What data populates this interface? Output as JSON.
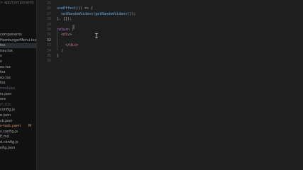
{
  "sidebar": {
    "breadcrumb": "> app/components",
    "items": [
      {
        "label": "components",
        "state": "normal"
      },
      {
        "label": "HamburgerMenu.tsx",
        "state": "normal"
      },
      {
        "label": "tsx",
        "state": "selected"
      },
      {
        "label": "nav.tsx",
        "state": "normal"
      },
      {
        "label": "s",
        "state": "normal"
      },
      {
        "label": "s",
        "state": "normal"
      },
      {
        "label": "ex.tsx",
        "state": "normal"
      },
      {
        "label": "tsx",
        "state": "normal"
      },
      {
        "label": "ex.tsx",
        "state": "normal"
      },
      {
        "label": "tsx",
        "state": "normal"
      },
      {
        "label": "modules",
        "state": "dim"
      },
      {
        "label": "rs.json",
        "state": "normal"
      },
      {
        "label": "ore",
        "state": "normal"
      },
      {
        "label": "m.d.ts",
        "state": "dim"
      },
      {
        "label": "config.js",
        "state": "normal"
      },
      {
        "label": "e.json",
        "state": "normal"
      },
      {
        "label": "ck.json",
        "state": "normal"
      },
      {
        "label": "n-lock.yaml",
        "state": "modified"
      },
      {
        "label": "s.config.js",
        "state": "normal"
      },
      {
        "label": "E.md",
        "state": "normal"
      },
      {
        "label": "d.config.js",
        "state": "normal"
      },
      {
        "label": "nfig.json",
        "state": "normal"
      }
    ],
    "modified_badge": "M"
  },
  "editor": {
    "line_numbers": [
      "25",
      "26",
      "27",
      "28",
      "29",
      "30",
      "31",
      "32",
      "33",
      "34",
      "35",
      "36"
    ],
    "active_line": "32",
    "lines": [
      [],
      [
        {
          "t": "useEffect",
          "c": "fn"
        },
        {
          "t": "(() => {",
          "c": "punc"
        }
      ],
      [
        {
          "t": "  setRandomVideos",
          "c": "fn"
        },
        {
          "t": "(",
          "c": "punc"
        },
        {
          "t": "getRandomVideos",
          "c": "fn"
        },
        {
          "t": "());",
          "c": "punc"
        }
      ],
      [
        {
          "t": "}, []);",
          "c": "punc"
        }
      ],
      [],
      [
        {
          "t": "return",
          "c": "kw"
        },
        {
          "t": " (",
          "c": "punc"
        }
      ],
      [
        {
          "t": "  <",
          "c": "punc"
        },
        {
          "t": "div",
          "c": "tag"
        },
        {
          "t": ">",
          "c": "punc"
        }
      ],
      [],
      [
        {
          "t": "    </",
          "c": "punc"
        },
        {
          "t": "div",
          "c": "tag"
        },
        {
          "t": ">",
          "c": "punc"
        }
      ],
      [
        {
          "t": "  )",
          "c": "punc"
        }
      ],
      [
        {
          "t": "}",
          "c": "punc"
        }
      ],
      []
    ]
  },
  "colors": {
    "background": "#1e1e1e",
    "sidebar": "#111111",
    "keyword": "#c678dd",
    "function": "#61afef",
    "tag": "#e06c75",
    "modified": "#d19a66"
  }
}
